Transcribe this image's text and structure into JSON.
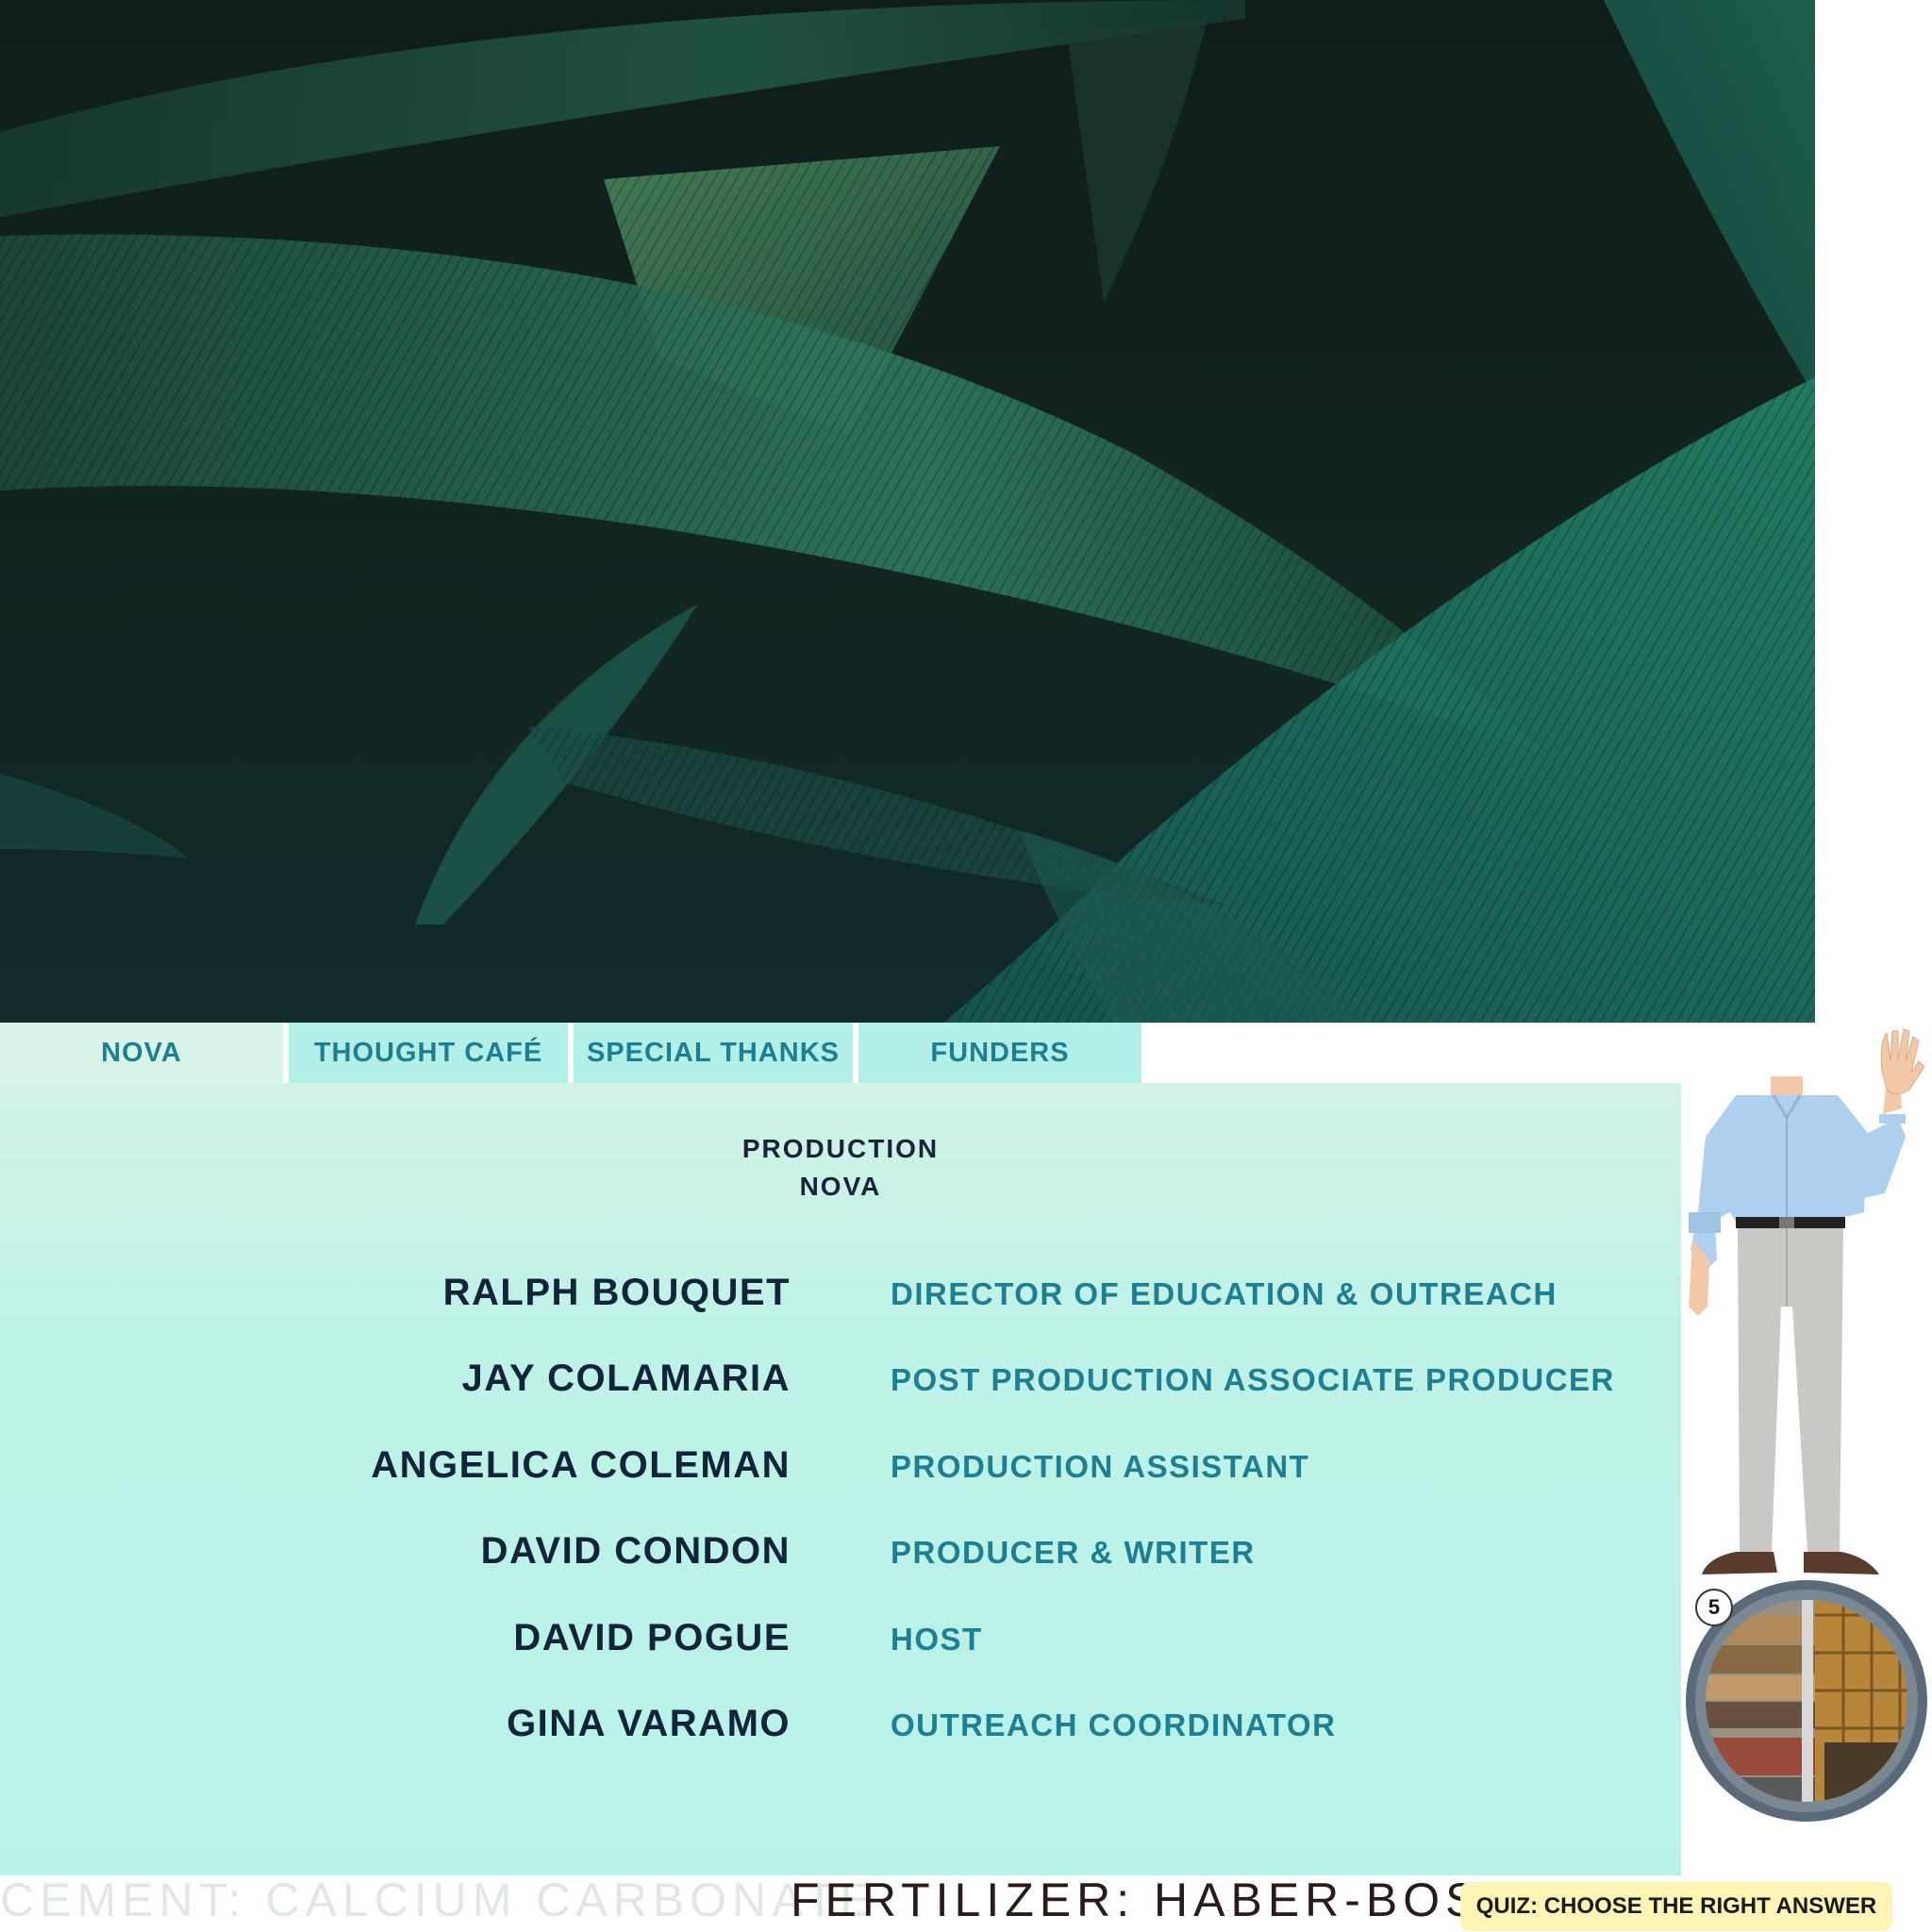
{
  "tabs": [
    {
      "label": "NOVA",
      "active": true
    },
    {
      "label": "THOUGHT CAFÉ",
      "active": false
    },
    {
      "label": "SPECIAL THANKS",
      "active": false
    },
    {
      "label": "FUNDERS",
      "active": false
    }
  ],
  "credits": {
    "heading_line1": "PRODUCTION",
    "heading_line2": "NOVA",
    "entries": [
      {
        "name": "RALPH BOUQUET",
        "role": "DIRECTOR OF EDUCATION & OUTREACH"
      },
      {
        "name": "JAY COLAMARIA",
        "role": "POST PRODUCTION ASSOCIATE PRODUCER"
      },
      {
        "name": "ANGELICA COLEMAN",
        "role": "PRODUCTION ASSISTANT"
      },
      {
        "name": "DAVID CONDON",
        "role": "PRODUCER & WRITER"
      },
      {
        "name": "DAVID POGUE",
        "role": "HOST"
      },
      {
        "name": "GINA VARAMO",
        "role": "OUTREACH COORDINATOR"
      }
    ]
  },
  "quiz_badge": "5",
  "ticker": {
    "faded_text": "CEMENT: CALCIUM CARBONATE",
    "dark_text": "FERTILIZER: HABER-BOSCH"
  },
  "quiz_button_label": "QUIZ: CHOOSE THE RIGHT ANSWER",
  "icons": {
    "hero": "palm-leaves-image",
    "character": "waving-character",
    "quiz_circle": "building-photo-circle"
  },
  "colors": {
    "tab_text": "#1e7f93",
    "name_text": "#12243a",
    "panel_bg": "#b7f2e8",
    "quiz_button_bg": "#fdf4b5"
  }
}
